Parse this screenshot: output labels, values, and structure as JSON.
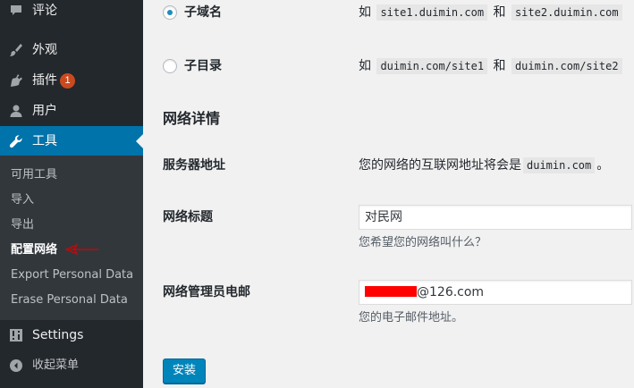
{
  "sidebar": {
    "menu": [
      {
        "label": "评论",
        "icon": "comment-icon"
      },
      {
        "label": "外观",
        "icon": "paintbrush-icon"
      },
      {
        "label": "插件",
        "icon": "plugin-icon",
        "badge": "1"
      },
      {
        "label": "用户",
        "icon": "user-icon"
      },
      {
        "label": "工具",
        "icon": "wrench-icon"
      }
    ],
    "submenu": [
      "可用工具",
      "导入",
      "导出",
      "配置网络",
      "Export Personal Data",
      "Erase Personal Data"
    ],
    "settings_label": "Settings",
    "collapse_label": "收起菜单"
  },
  "main": {
    "options": [
      {
        "label": "子域名",
        "checked": true,
        "prefix": "如",
        "ex1": "site1.duimin.com",
        "conj": "和",
        "ex2": "site2.duimin.com"
      },
      {
        "label": "子目录",
        "checked": false,
        "prefix": "如",
        "ex1": "duimin.com/site1",
        "conj": "和",
        "ex2": "duimin.com/site2"
      }
    ],
    "section_title": "网络详情",
    "server": {
      "label": "服务器地址",
      "text_before": "您的网络的互联网地址将会是",
      "code": "duimin.com",
      "text_after": "。"
    },
    "title_field": {
      "label": "网络标题",
      "value": "对民网",
      "description": "您希望您的网络叫什么？"
    },
    "email_field": {
      "label": "网络管理员电邮",
      "value_suffix": "@126.com",
      "description": "您的电子邮件地址。"
    },
    "install_button": "安装"
  },
  "colors": {
    "sidebar_bg": "#23282d",
    "submenu_bg": "#32373c",
    "accent": "#0073aa",
    "button": "#0085ba",
    "badge": "#ca4a1f"
  }
}
